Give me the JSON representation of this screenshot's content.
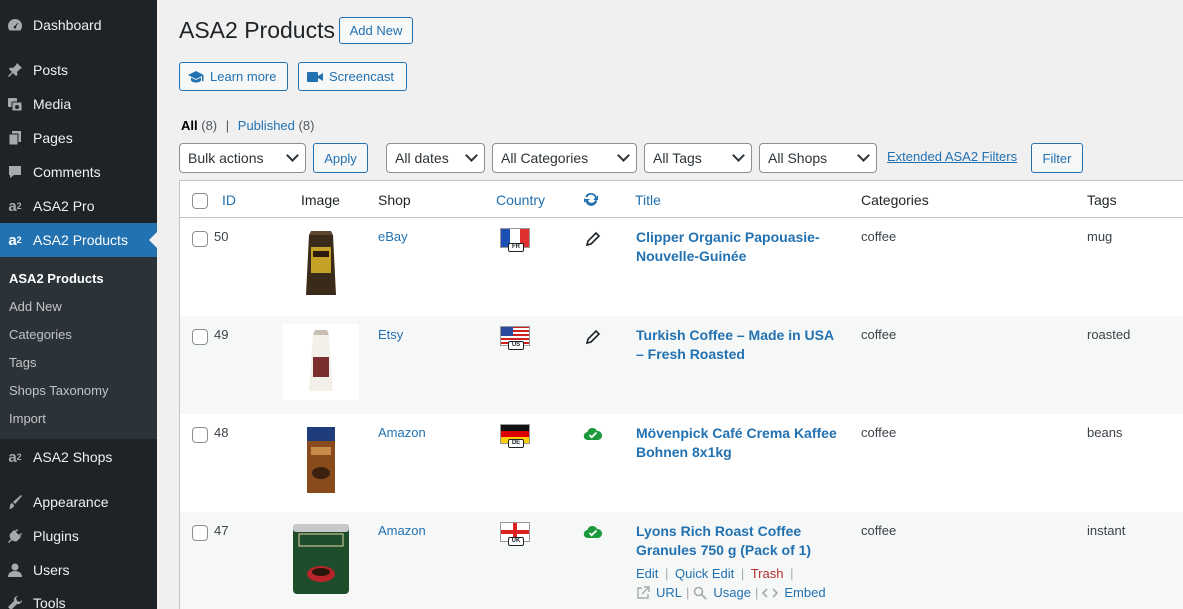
{
  "sidebar": {
    "items": [
      {
        "label": "Dashboard",
        "icon": "dashboard-icon"
      },
      {
        "label": "Posts",
        "icon": "pin-icon"
      },
      {
        "label": "Media",
        "icon": "media-icon"
      },
      {
        "label": "Pages",
        "icon": "pages-icon"
      },
      {
        "label": "Comments",
        "icon": "comment-icon"
      },
      {
        "label": "ASA2 Pro",
        "icon": "asa2-icon"
      },
      {
        "label": "ASA2 Products",
        "icon": "asa2-icon"
      },
      {
        "label": "ASA2 Shops",
        "icon": "asa2-icon"
      },
      {
        "label": "Appearance",
        "icon": "brush-icon"
      },
      {
        "label": "Plugins",
        "icon": "plug-icon"
      },
      {
        "label": "Users",
        "icon": "user-icon"
      },
      {
        "label": "Tools",
        "icon": "wrench-icon"
      }
    ],
    "submenu": [
      "ASA2 Products",
      "Add New",
      "Categories",
      "Tags",
      "Shops Taxonomy",
      "Import"
    ]
  },
  "page": {
    "title": "ASA2 Products",
    "add_new": "Add New",
    "learn_more": "Learn more",
    "screencast": "Screencast"
  },
  "views": {
    "all_label": "All",
    "all_count": "(8)",
    "sep": "|",
    "published_label": "Published",
    "published_count": "(8)"
  },
  "filters": {
    "bulk_actions": "Bulk actions",
    "apply": "Apply",
    "dates": "All dates",
    "categories": "All Categories",
    "tags": "All Tags",
    "shops": "All Shops",
    "extended": "Extended ASA2 Filters",
    "filter": "Filter"
  },
  "table": {
    "headers": {
      "id": "ID",
      "image": "Image",
      "shop": "Shop",
      "country": "Country",
      "title": "Title",
      "categories": "Categories",
      "tags": "Tags"
    },
    "rows": [
      {
        "id": "50",
        "shop": "eBay",
        "country": "FR",
        "status_icon": "pencil-icon",
        "title_1": "Clipper Organic Papouasie-",
        "title_2": "Nouvelle-Guinée",
        "category": "coffee",
        "tag": "mug"
      },
      {
        "id": "49",
        "shop": "Etsy",
        "country": "US",
        "status_icon": "pencil-icon",
        "title_1": "Turkish Coffee – Made in USA",
        "title_2": "– Fresh Roasted",
        "category": "coffee",
        "tag": "roasted"
      },
      {
        "id": "48",
        "shop": "Amazon",
        "country": "DE",
        "status_icon": "cloud-check-icon",
        "title_1": "Mövenpick Café Crema Kaffee",
        "title_2": "Bohnen 8x1kg",
        "category": "coffee",
        "tag": "beans"
      },
      {
        "id": "47",
        "shop": "Amazon",
        "country": "UK",
        "status_icon": "cloud-check-icon",
        "title_1": "Lyons Rich Roast Coffee",
        "title_2": "Granules 750 g (Pack of 1)",
        "category": "coffee",
        "tag": "instant"
      }
    ],
    "row_actions": {
      "edit": "Edit",
      "quick_edit": "Quick Edit",
      "trash": "Trash",
      "url": "URL",
      "usage": "Usage",
      "embed": "Embed",
      "sep": "|"
    }
  },
  "colors": {
    "accent": "#2271b1",
    "sidebar_bg": "#1d2327",
    "status_green": "#1a9a3a"
  }
}
